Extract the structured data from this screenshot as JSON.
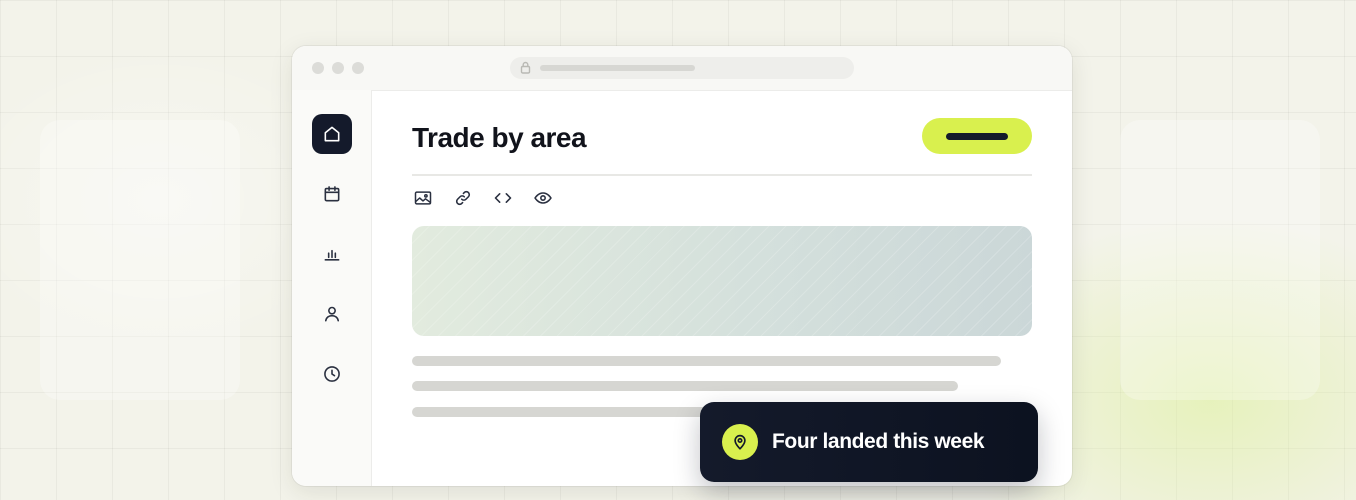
{
  "page": {
    "title": "Trade by area"
  },
  "colors": {
    "accent": "#d9f04e",
    "dark": "#141a2b",
    "background": "#f3f3ea"
  },
  "sidebar": {
    "items": [
      {
        "icon": "home-icon",
        "active": true
      },
      {
        "icon": "calendar-icon",
        "active": false
      },
      {
        "icon": "bar-chart-icon",
        "active": false
      },
      {
        "icon": "user-icon",
        "active": false
      },
      {
        "icon": "clock-icon",
        "active": false
      }
    ]
  },
  "toolbar": {
    "tools": [
      "image-icon",
      "link-icon",
      "code-icon",
      "eye-icon"
    ]
  },
  "toast": {
    "icon": "map-pin-icon",
    "message": "Four landed this week"
  }
}
